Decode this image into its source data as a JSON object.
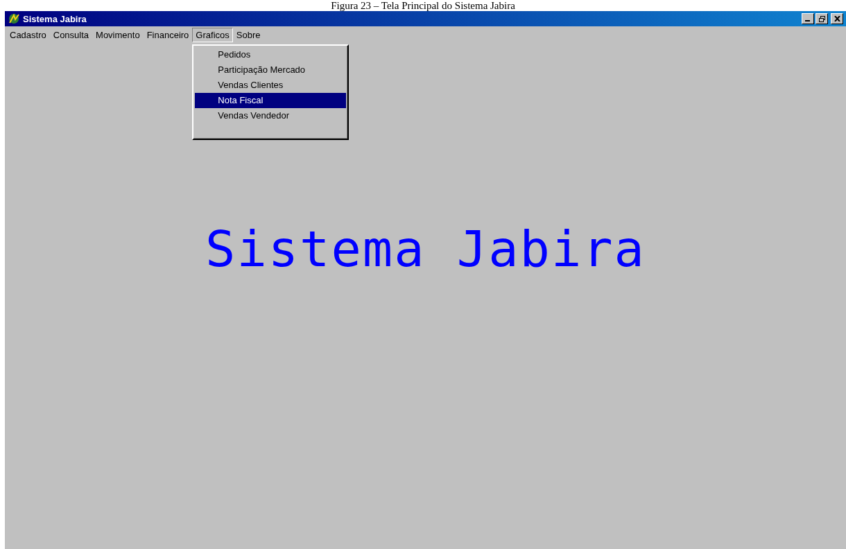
{
  "caption": "Figura 23 – Tela Principal do Sistema Jabira",
  "window": {
    "title": "Sistema Jabira"
  },
  "menu_bar": [
    {
      "label": "Cadastro",
      "selected": false
    },
    {
      "label": "Consulta",
      "selected": false
    },
    {
      "label": "Movimento",
      "selected": false
    },
    {
      "label": "Financeiro",
      "selected": false
    },
    {
      "label": "Graficos",
      "selected": true
    },
    {
      "label": "Sobre",
      "selected": false
    }
  ],
  "dropdown": [
    {
      "label": "Pedidos",
      "selected": false
    },
    {
      "label": "Participação Mercado",
      "selected": false
    },
    {
      "label": "Vendas Clientes",
      "selected": false
    },
    {
      "label": "Nota Fiscal",
      "selected": true
    },
    {
      "label": "Vendas Vendedor",
      "selected": false
    }
  ],
  "banner": "Sistema Jabira"
}
